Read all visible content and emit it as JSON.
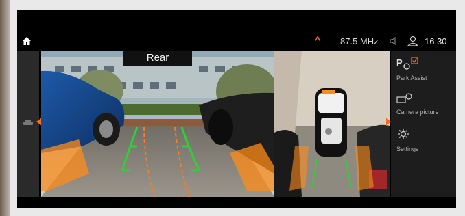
{
  "status": {
    "radio": "87.5 MHz",
    "time": "16:30"
  },
  "rear_view": {
    "label": "Rear"
  },
  "menu": {
    "park_assist": "Park Assist",
    "camera_picture": "Camera picture",
    "settings": "Settings",
    "park_glyph": "P"
  },
  "colors": {
    "accent": "#ff6a1a",
    "guide_green": "#2fcf3a",
    "screen_bg": "#000000"
  }
}
